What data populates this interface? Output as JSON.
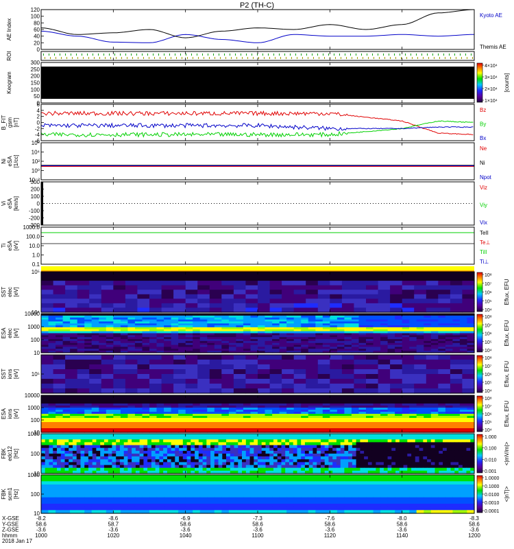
{
  "title": "P2 (TH-C)",
  "colors": {
    "black": "#000000",
    "red": "#e00000",
    "green": "#00d000",
    "blue": "#0000c8",
    "orange": "#ff7a00"
  },
  "panels": [
    {
      "id": "ae",
      "ylabel": [
        "AE Index"
      ],
      "ticks": [
        "120",
        "100",
        "80",
        "60",
        "40",
        "20",
        "0"
      ],
      "legend": [
        {
          "text": "Kyoto AE",
          "color": "#0000c8"
        },
        {
          "text": "Themis AE",
          "color": "#000000"
        }
      ]
    },
    {
      "id": "roi",
      "ylabel": [
        "ROI"
      ],
      "ticks": [],
      "legend": []
    },
    {
      "id": "keogram",
      "ylabel": [
        "Keogram"
      ],
      "ticks": [
        "300",
        "250",
        "200",
        "150",
        "100",
        "50",
        "0"
      ],
      "legend": []
    },
    {
      "id": "bfit",
      "ylabel": [
        "B_FIT",
        "gsm",
        "[nT]"
      ],
      "ticks": [
        "6",
        "4",
        "2",
        "0",
        "-2",
        "-4",
        "-6"
      ],
      "legend": [
        {
          "text": "Bz",
          "color": "#e00000"
        },
        {
          "text": "By",
          "color": "#00d000"
        },
        {
          "text": "Bx",
          "color": "#0000c8"
        }
      ]
    },
    {
      "id": "ni",
      "ylabel": [
        "Ni",
        "eSA",
        "[1/cc]"
      ],
      "ticks": [
        "10⁶",
        "10⁴",
        "10²",
        "10⁰",
        "10⁻²"
      ],
      "legend": [
        {
          "text": "Ne",
          "color": "#e00000"
        },
        {
          "text": "Ni",
          "color": "#000000"
        },
        {
          "text": "Npot",
          "color": "#0000c8"
        }
      ]
    },
    {
      "id": "vi",
      "ylabel": [
        "Vi",
        "eSA",
        "[km/s]"
      ],
      "ticks": [
        "300",
        "200",
        "100",
        "0",
        "-100",
        "-200",
        "-300"
      ],
      "legend": [
        {
          "text": "Viz",
          "color": "#e00000"
        },
        {
          "text": "Viy",
          "color": "#00d000"
        },
        {
          "text": "Vix",
          "color": "#0000c8"
        }
      ]
    },
    {
      "id": "ti",
      "ylabel": [
        "Ti",
        "eSA",
        "[eV]"
      ],
      "ticks": [
        "1000.0",
        "100.0",
        "10.0",
        "1.0",
        "0.1"
      ],
      "legend": [
        {
          "text": "TeII",
          "color": "#000000"
        },
        {
          "text": "Te⊥",
          "color": "#e00000"
        },
        {
          "text": "TiII",
          "color": "#00d000"
        },
        {
          "text": "Ti⊥",
          "color": "#0000c8"
        }
      ]
    },
    {
      "id": "sste",
      "ylabel": [
        "SST",
        "elec",
        "[eV]"
      ],
      "ticks": [
        "10⁵",
        "10⁴"
      ],
      "legend": []
    },
    {
      "id": "esae",
      "ylabel": [
        "ESA",
        "elec",
        "[eV]"
      ],
      "ticks": [
        "10000",
        "1000",
        "100",
        "10"
      ],
      "legend": []
    },
    {
      "id": "ssti",
      "ylabel": [
        "SST",
        "ions",
        "[eV]"
      ],
      "ticks": [
        "10⁵"
      ],
      "legend": []
    },
    {
      "id": "esai",
      "ylabel": [
        "ESA",
        "ions",
        "[eV]"
      ],
      "ticks": [
        "10000",
        "1000",
        "100",
        "10"
      ],
      "legend": []
    },
    {
      "id": "fbke",
      "ylabel": [
        "FBK",
        "edc12",
        "[Hz]"
      ],
      "ticks": [
        "1000",
        "100",
        "10"
      ],
      "legend": []
    },
    {
      "id": "fbkb",
      "ylabel": [
        "FBK",
        "scm1",
        "[Hz]"
      ],
      "ticks": [
        "1000",
        "100",
        "10"
      ],
      "legend": []
    }
  ],
  "colorbars": [
    {
      "id": "keogram",
      "ticks": [
        "4×10⁴",
        "3×10⁴",
        "2×10⁴",
        "1×10⁴"
      ],
      "label": "[counts]"
    },
    {
      "id": "sste",
      "ticks": [
        "10⁸",
        "10⁷",
        "10⁶",
        "10⁵",
        "10⁴"
      ],
      "label": "Eflux, EFU"
    },
    {
      "id": "esae",
      "ticks": [
        "10⁸",
        "10⁷",
        "10⁶",
        "10⁵",
        "10⁴"
      ],
      "label": "Eflux, EFU"
    },
    {
      "id": "ssti",
      "ticks": [
        "10⁸",
        "10⁷",
        "10⁶",
        "10⁵",
        "10⁴"
      ],
      "label": "Eflux, EFU"
    },
    {
      "id": "esai",
      "ticks": [
        "10⁸",
        "10⁷",
        "10⁶",
        "10⁵",
        "10⁴"
      ],
      "label": "Eflux, EFU"
    },
    {
      "id": "fbke",
      "ticks": [
        "1.000",
        "0.100",
        "0.010",
        "0.001"
      ],
      "label": "<|mV/m|>"
    },
    {
      "id": "fbkb",
      "ticks": [
        "1.0000",
        "0.1000",
        "0.0100",
        "0.0010",
        "0.0001"
      ],
      "label": "<|nT|>"
    }
  ],
  "footer": {
    "row_labels": [
      "X-GSE",
      "Y-GSE",
      "Z-GSE",
      "hhmm",
      "2018 Jan 17"
    ],
    "columns": [
      {
        "vals": [
          "-8.2",
          "58.6",
          "-3.6",
          "1000"
        ]
      },
      {
        "vals": [
          "-8.6",
          "58.7",
          "-3.6",
          "1020"
        ]
      },
      {
        "vals": [
          "-6.9",
          "58.6",
          "-3.6",
          "1040"
        ]
      },
      {
        "vals": [
          "-7.3",
          "58.6",
          "-3.6",
          "1100"
        ]
      },
      {
        "vals": [
          "-7.6",
          "58.6",
          "-3.6",
          "1120"
        ]
      },
      {
        "vals": [
          "-8.0",
          "58.6",
          "-3.6",
          "1140"
        ]
      },
      {
        "vals": [
          "-8.3",
          "58.6",
          "-3.6",
          "1200"
        ]
      }
    ]
  },
  "chart_data": {
    "type": "line",
    "title": "P2 (TH-C)",
    "x_ticks": [
      "1000",
      "1020",
      "1040",
      "1100",
      "1120",
      "1140",
      "1200"
    ],
    "x_label": "hhmm",
    "date": "2018 Jan 17",
    "series": [
      {
        "name": "Kyoto AE",
        "panel": "ae",
        "color": "#0000c8",
        "x": [
          0,
          10,
          20,
          30,
          40,
          50,
          60,
          70,
          80,
          90,
          100,
          110,
          120
        ],
        "values": [
          55,
          40,
          22,
          20,
          45,
          30,
          20,
          45,
          40,
          40,
          45,
          40,
          45
        ]
      },
      {
        "name": "Themis AE",
        "panel": "ae",
        "color": "#000000",
        "x": [
          0,
          10,
          20,
          30,
          40,
          50,
          60,
          70,
          80,
          90,
          100,
          110,
          120
        ],
        "values": [
          65,
          45,
          50,
          60,
          35,
          55,
          65,
          60,
          75,
          60,
          75,
          110,
          120
        ]
      },
      {
        "name": "Bz",
        "panel": "bfit",
        "color": "#e00000",
        "x": [
          0,
          20,
          40,
          60,
          80,
          100,
          110,
          120
        ],
        "values": [
          3,
          3,
          3,
          3,
          3,
          0.5,
          -3.5,
          -4
        ]
      },
      {
        "name": "By",
        "panel": "bfit",
        "color": "#00d000",
        "x": [
          0,
          20,
          40,
          60,
          80,
          100,
          110,
          120
        ],
        "values": [
          -4,
          -4,
          -4,
          -4,
          -4,
          -2,
          0.5,
          0
        ]
      },
      {
        "name": "Bx",
        "panel": "bfit",
        "color": "#0000c8",
        "x": [
          0,
          20,
          40,
          60,
          80,
          100,
          110,
          120
        ],
        "values": [
          -1,
          -1,
          -1,
          -1,
          -2,
          -2,
          -1.5,
          -1.5
        ]
      }
    ]
  }
}
